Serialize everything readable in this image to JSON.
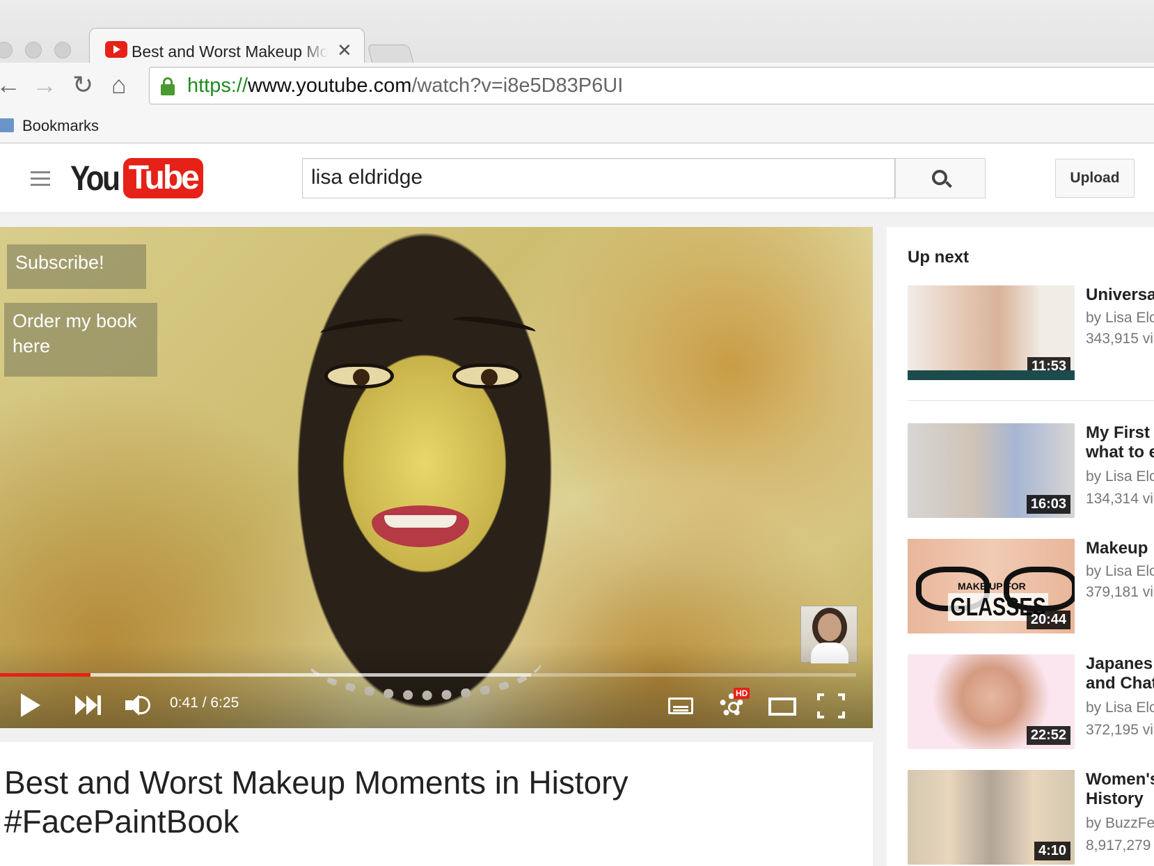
{
  "browser": {
    "tab_title": "Best and Worst Makeup Moments in History #FacePaintBook - YouTube",
    "tab_close": "✕",
    "url_scheme": "https://",
    "url_host": "www.youtube.com",
    "url_path": "/watch?v=i8e5D83P6UI",
    "bookmarks_label": "Bookmarks",
    "nav_back": "←",
    "nav_forward": "→",
    "nav_reload": "↻",
    "nav_home": "⌂"
  },
  "header": {
    "logo_you": "You",
    "logo_tube": "Tube",
    "search_value": "lisa eldridge",
    "upload_label": "Upload"
  },
  "player": {
    "annotations": [
      "Subscribe!",
      "Order my book here"
    ],
    "current_time": "0:41",
    "duration": "6:25",
    "time_display": "0:41 / 6:25",
    "played_fraction": 0.106,
    "buffered_fraction": 0.62,
    "hd_badge": "HD"
  },
  "video": {
    "title": "Best and Worst Makeup Moments in History #FacePaintBook"
  },
  "sidebar": {
    "up_next_label": "Up next",
    "items": [
      {
        "title": "Universa",
        "channel": "by Lisa Elc",
        "views": "343,915 vi",
        "duration": "11:53"
      },
      {
        "title": "My First",
        "title_line2": "what to e",
        "channel": "by Lisa Elc",
        "views": "134,314 vi",
        "duration": "16:03"
      },
      {
        "title": "Makeup",
        "channel": "by Lisa Elc",
        "views": "379,181 vi",
        "duration": "20:44",
        "thumb_text_small": "MAKE UP FOR",
        "thumb_text": "GLASSES"
      },
      {
        "title": "Japanes",
        "title_line2": "and Chat",
        "channel": "by Lisa Elc",
        "views": "372,195 vi",
        "duration": "22:52"
      },
      {
        "title": "Women's",
        "title_line2": "History",
        "channel": "by BuzzFe",
        "views": "8,917,279",
        "duration": "4:10"
      }
    ]
  },
  "colors": {
    "youtube_red": "#e62117",
    "secure_green": "#1e8c1e"
  }
}
